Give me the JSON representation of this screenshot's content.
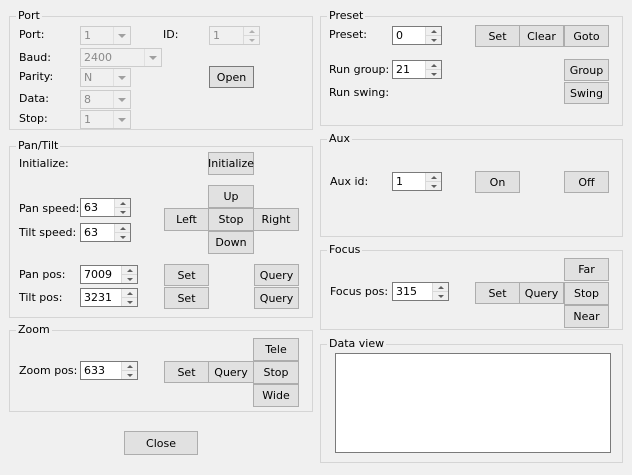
{
  "port": {
    "legend": "Port",
    "port_label": "Port:",
    "port_value": "1",
    "id_label": "ID:",
    "id_value": "1",
    "baud_label": "Baud:",
    "baud_value": "2400",
    "parity_label": "Parity:",
    "parity_value": "N",
    "data_label": "Data:",
    "data_value": "8",
    "stop_label": "Stop:",
    "stop_value": "1",
    "open_button": "Open"
  },
  "pantilt": {
    "legend": "Pan/Tilt",
    "initialize_label": "Initialize:",
    "initialize_button": "Initialize",
    "pan_speed_label": "Pan speed:",
    "pan_speed_value": "63",
    "tilt_speed_label": "Tilt speed:",
    "tilt_speed_value": "63",
    "up_button": "Up",
    "left_button": "Left",
    "stop_button": "Stop",
    "right_button": "Right",
    "down_button": "Down",
    "pan_pos_label": "Pan pos:",
    "pan_pos_value": "7009",
    "pan_set_button": "Set",
    "pan_query_button": "Query",
    "tilt_pos_label": "Tilt pos:",
    "tilt_pos_value": "3231",
    "tilt_set_button": "Set",
    "tilt_query_button": "Query"
  },
  "zoom": {
    "legend": "Zoom",
    "zoom_pos_label": "Zoom pos:",
    "zoom_pos_value": "633",
    "set_button": "Set",
    "query_button": "Query",
    "tele_button": "Tele",
    "stop_button": "Stop",
    "wide_button": "Wide"
  },
  "close_button": "Close",
  "preset": {
    "legend": "Preset",
    "preset_label": "Preset:",
    "preset_value": "0",
    "set_button": "Set",
    "clear_button": "Clear",
    "goto_button": "Goto",
    "run_group_label": "Run group:",
    "run_group_value": "21",
    "group_button": "Group",
    "run_swing_label": "Run swing:",
    "swing_button": "Swing"
  },
  "aux": {
    "legend": "Aux",
    "aux_id_label": "Aux id:",
    "aux_id_value": "1",
    "on_button": "On",
    "off_button": "Off"
  },
  "focus": {
    "legend": "Focus",
    "focus_pos_label": "Focus pos:",
    "focus_pos_value": "315",
    "set_button": "Set",
    "query_button": "Query",
    "far_button": "Far",
    "stop_button": "Stop",
    "near_button": "Near"
  },
  "dataview": {
    "legend": "Data view"
  }
}
